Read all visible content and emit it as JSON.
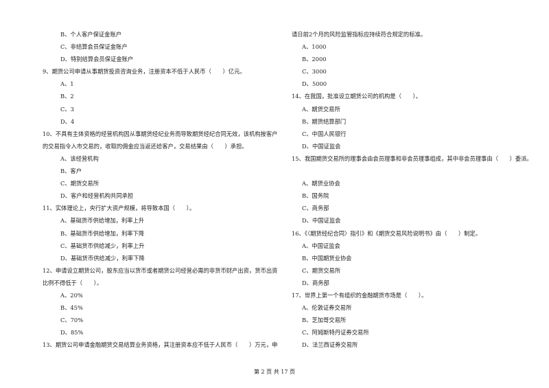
{
  "left": [
    {
      "text": [],
      "options": [
        "B、个人客户保证金账户",
        "C、非结算会员保证金账户",
        "D、特别结算会员保证金账户"
      ]
    },
    {
      "text": [
        "9、期货公司申请从事期货投资咨询业务，注册资本不低于人民币（　　）亿元。"
      ],
      "options": [
        "A、1",
        "B、2",
        "C、3",
        "D、4"
      ]
    },
    {
      "text": [
        "10、不具有主体资格的经营机构因从事期货经纪业务而导致期货经纪合同无效，该机构按客户",
        "的交易指令入市交易的，收取的佣金应当返还给客户，交易结果由（　　）承担。"
      ],
      "options": [
        "A、该经营机构",
        "B、客户",
        "C、期货交易所",
        "D、客户和经营机构共同承担"
      ]
    },
    {
      "text": [
        "11、实体理论上，央行扩大资产规模，将导致本国（　　）。"
      ],
      "options": [
        "A、基础货币供给增加，利率上升",
        "B、基础货币供给增加，利率下降",
        "C、基础货币供给减少，利率上升",
        "D、基础货币供给减少，利率下降"
      ]
    },
    {
      "text": [
        "12、申请设立期货公司，股东应当以货币或者期货公司经营必需的非货币财产出资，货币出资",
        "比例不得低于（　　）。"
      ],
      "options": [
        "A、20%",
        "B、45%",
        "C、70%",
        "D、85%"
      ]
    },
    {
      "text": [
        "13、期货公司申请金融期货交易结算业务资格，其注册资本应不低于人民币（　　）万元，申"
      ],
      "options": []
    }
  ],
  "right": [
    {
      "text": [
        "请日前2个月的风险监管指标应持续符合规定的标准。"
      ],
      "options": [
        "A、1000",
        "B、2000",
        "C、3000",
        "D、5000"
      ]
    },
    {
      "text": [
        "14、在我国，批准设立期货公司的机构是（　　）。"
      ],
      "options": [
        "A、期货交易所",
        "B、期货结算部门",
        "C、中国人民银行",
        "D、中国证监会"
      ]
    },
    {
      "text": [
        "15、我国期货交易所的理事会由会员理事和非会员理事组成，其中非会员理事由（　　）委派。"
      ],
      "options": [
        "A、期货业协会",
        "B、国务院",
        "C、商务部",
        "D、中国证监会"
      ]
    },
    {
      "text": [
        "16、《〈期货经纪合同〉指引》和《期货交易风险说明书》由（　　）制定。"
      ],
      "options": [
        "A、中国证监会",
        "B、中国期货业协会",
        "C、期货交易所",
        "D、商务部"
      ]
    },
    {
      "text": [
        "17、世界上第一个有组织的金融期货市场是（　　）。"
      ],
      "options": [
        "A、伦敦证券交易所",
        "B、芝加哥交易所",
        "C、阿姆斯特丹证券交易所",
        "D、法兰西证券交易所"
      ]
    }
  ],
  "footer": {
    "page_label": "第 2 页 共 17 页"
  }
}
